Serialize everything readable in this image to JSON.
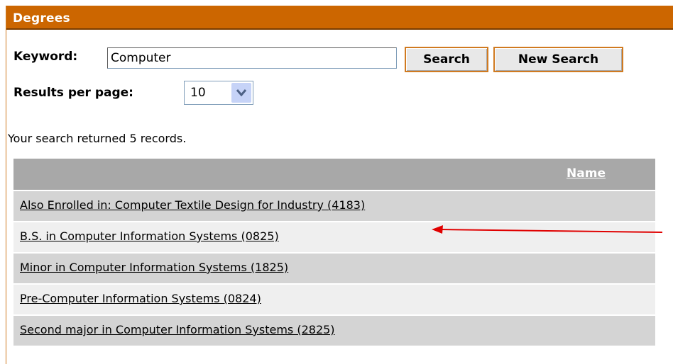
{
  "header": {
    "title": "Degrees"
  },
  "search": {
    "keyword_label": "Keyword:",
    "keyword_value": "Computer",
    "search_button": "Search",
    "new_search_button": "New Search",
    "results_per_page_label": "Results per page:",
    "results_per_page_value": "10"
  },
  "results": {
    "summary": "Your search returned 5 records.",
    "column_header": "Name",
    "rows": [
      "Also Enrolled in: Computer Textile Design for Industry (4183)",
      "B.S. in Computer Information Systems (0825)",
      "Minor in Computer Information Systems (1825)",
      "Pre-Computer Information Systems (0824)",
      "Second major in Computer Information Systems (2825)"
    ]
  },
  "colors": {
    "header_bg": "#cc6600",
    "table_header_bg": "#a8a8a8",
    "annotation_arrow": "#e00000"
  }
}
